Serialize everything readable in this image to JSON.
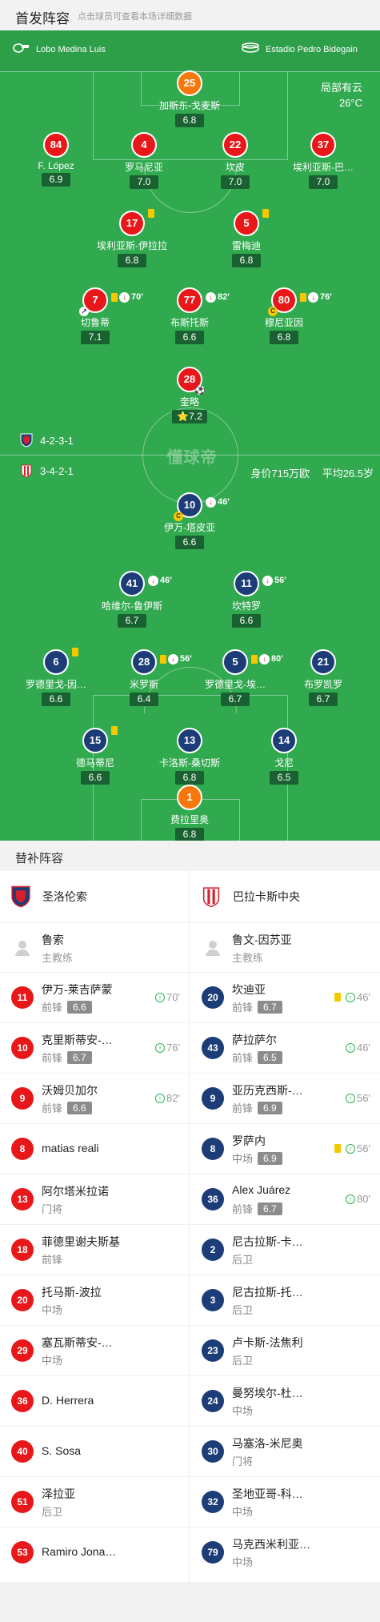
{
  "header": {
    "title": "首发阵容",
    "subtitle": "点击球员可查看本场详细数据"
  },
  "match": {
    "coach_home": "Lobo Medina Luis",
    "stadium": "Estadio Pedro Bidegain",
    "weather": "局部有云",
    "temperature": "26°C",
    "watermark": "懂球帝",
    "home_formation": "4-2-3-1",
    "away_formation": "3-4-2-1",
    "value": "身价715万欧",
    "avg_age": "平均26.5岁"
  },
  "home_players": [
    {
      "num": "25",
      "name": "加斯东-戈麦斯",
      "rating": "6.8",
      "gk": true
    },
    {
      "num": "84",
      "name": "F. López",
      "rating": "6.9"
    },
    {
      "num": "4",
      "name": "罗马尼亚",
      "rating": "7.0"
    },
    {
      "num": "22",
      "name": "坎皮",
      "rating": "7.0"
    },
    {
      "num": "37",
      "name": "埃利亚斯-巴…",
      "rating": "7.0"
    },
    {
      "num": "17",
      "name": "埃利亚斯-伊拉拉",
      "rating": "6.8"
    },
    {
      "num": "5",
      "name": "雷梅迪",
      "rating": "6.8"
    },
    {
      "num": "7",
      "name": "切鲁蒂",
      "rating": "7.1",
      "sub_time": "70'"
    },
    {
      "num": "77",
      "name": "布斯托斯",
      "rating": "6.6",
      "sub_time": "82'"
    },
    {
      "num": "80",
      "name": "穆尼亚因",
      "rating": "6.8",
      "sub_time": "76'"
    },
    {
      "num": "28",
      "name": "奎略",
      "rating": "7.2"
    }
  ],
  "away_players": [
    {
      "num": "10",
      "name": "伊万-塔皮亚",
      "rating": "6.6",
      "sub_time": "46'"
    },
    {
      "num": "41",
      "name": "哈维尔-鲁伊斯",
      "rating": "6.7",
      "sub_time": "46'"
    },
    {
      "num": "11",
      "name": "坎特罗",
      "rating": "6.6",
      "sub_time": "56'"
    },
    {
      "num": "6",
      "name": "罗德里戈-因…",
      "rating": "6.6"
    },
    {
      "num": "28",
      "name": "米罗斯",
      "rating": "6.4",
      "sub_time": "56'"
    },
    {
      "num": "5",
      "name": "罗德里戈-埃…",
      "rating": "6.7",
      "sub_time": "80'"
    },
    {
      "num": "21",
      "name": "布罗凯罗",
      "rating": "6.7"
    },
    {
      "num": "15",
      "name": "德马蒂尼",
      "rating": "6.6"
    },
    {
      "num": "13",
      "name": "卡洛斯-桑切斯",
      "rating": "6.8"
    },
    {
      "num": "14",
      "name": "戈尼",
      "rating": "6.5"
    },
    {
      "num": "1",
      "name": "费拉里奥",
      "rating": "6.8",
      "gk": true
    }
  ],
  "subs": {
    "title": "替补阵容",
    "home": {
      "team": "圣洛伦索",
      "coach": {
        "name": "鲁索",
        "role": "主教练"
      },
      "players": [
        {
          "num": "11",
          "name": "伊万-莱吉萨蒙",
          "pos": "前锋",
          "rating": "6.6",
          "time": "70'"
        },
        {
          "num": "10",
          "name": "克里斯蒂安-…",
          "pos": "前锋",
          "rating": "6.7",
          "time": "76'"
        },
        {
          "num": "9",
          "name": "沃姆贝加尔",
          "pos": "前锋",
          "rating": "6.6",
          "time": "82'"
        },
        {
          "num": "8",
          "name": "matias reali",
          "pos": "",
          "rating": "",
          "time": ""
        },
        {
          "num": "13",
          "name": "阿尔塔米拉诺",
          "pos": "门将",
          "rating": "",
          "time": ""
        },
        {
          "num": "18",
          "name": "菲德里谢夫斯基",
          "pos": "前锋",
          "rating": "",
          "time": ""
        },
        {
          "num": "20",
          "name": "托马斯-波拉",
          "pos": "中场",
          "rating": "",
          "time": ""
        },
        {
          "num": "29",
          "name": "塞瓦斯蒂安-…",
          "pos": "中场",
          "rating": "",
          "time": ""
        },
        {
          "num": "36",
          "name": "D. Herrera",
          "pos": "",
          "rating": "",
          "time": ""
        },
        {
          "num": "40",
          "name": "S. Sosa",
          "pos": "",
          "rating": "",
          "time": ""
        },
        {
          "num": "51",
          "name": "泽拉亚",
          "pos": "后卫",
          "rating": "",
          "time": ""
        },
        {
          "num": "53",
          "name": "Ramiro Jona…",
          "pos": "",
          "rating": "",
          "time": ""
        }
      ]
    },
    "away": {
      "team": "巴拉卡斯中央",
      "coach": {
        "name": "鲁文-因苏亚",
        "role": "主教练"
      },
      "players": [
        {
          "num": "20",
          "name": "坎迪亚",
          "pos": "前锋",
          "rating": "6.7",
          "time": "46'",
          "yellow": true
        },
        {
          "num": "43",
          "name": "萨拉萨尔",
          "pos": "前锋",
          "rating": "6.5",
          "time": "46'"
        },
        {
          "num": "9",
          "name": "亚历克西斯-…",
          "pos": "前锋",
          "rating": "6.9",
          "time": "56'"
        },
        {
          "num": "8",
          "name": "罗萨内",
          "pos": "中场",
          "rating": "6.9",
          "time": "56'",
          "yellow": true
        },
        {
          "num": "36",
          "name": "Alex Juárez",
          "pos": "前锋",
          "rating": "6.7",
          "time": "80'"
        },
        {
          "num": "2",
          "name": "尼古拉斯-卡…",
          "pos": "后卫",
          "rating": "",
          "time": ""
        },
        {
          "num": "3",
          "name": "尼古拉斯-托…",
          "pos": "后卫",
          "rating": "",
          "time": ""
        },
        {
          "num": "23",
          "name": "卢卡斯-法焦利",
          "pos": "后卫",
          "rating": "",
          "time": ""
        },
        {
          "num": "24",
          "name": "曼努埃尔-杜…",
          "pos": "中场",
          "rating": "",
          "time": ""
        },
        {
          "num": "30",
          "name": "马塞洛-米尼奥",
          "pos": "门将",
          "rating": "",
          "time": ""
        },
        {
          "num": "32",
          "name": "圣地亚哥-科…",
          "pos": "中场",
          "rating": "",
          "time": ""
        },
        {
          "num": "79",
          "name": "马克西米利亚…",
          "pos": "中场",
          "rating": "",
          "time": ""
        }
      ]
    }
  }
}
